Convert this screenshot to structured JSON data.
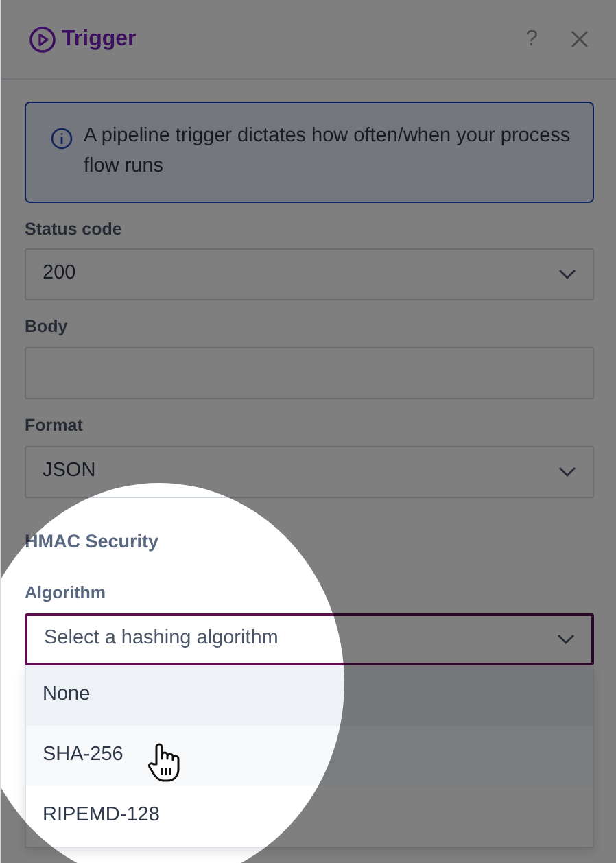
{
  "dialog": {
    "title": "Trigger",
    "help": "?"
  },
  "alert": {
    "text": "A pipeline trigger dictates how often/when your process flow runs"
  },
  "fields": [
    {
      "kind": "select",
      "label": "Status code",
      "value": "200"
    },
    {
      "kind": "text",
      "label": "Body"
    },
    {
      "kind": "select",
      "label": "Format",
      "value": "JSON"
    }
  ],
  "section": {
    "title": "HMAC Security"
  },
  "algorithm": {
    "label": "Algorithm",
    "placeholder": "Select a hashing algorithm",
    "expanded": true,
    "options": [
      {
        "label": "None",
        "selected": true,
        "hovered": false
      },
      {
        "label": "SHA-256",
        "selected": false,
        "hovered": true
      },
      {
        "label": "RIPEMD-128",
        "selected": false,
        "hovered": false
      }
    ]
  }
}
